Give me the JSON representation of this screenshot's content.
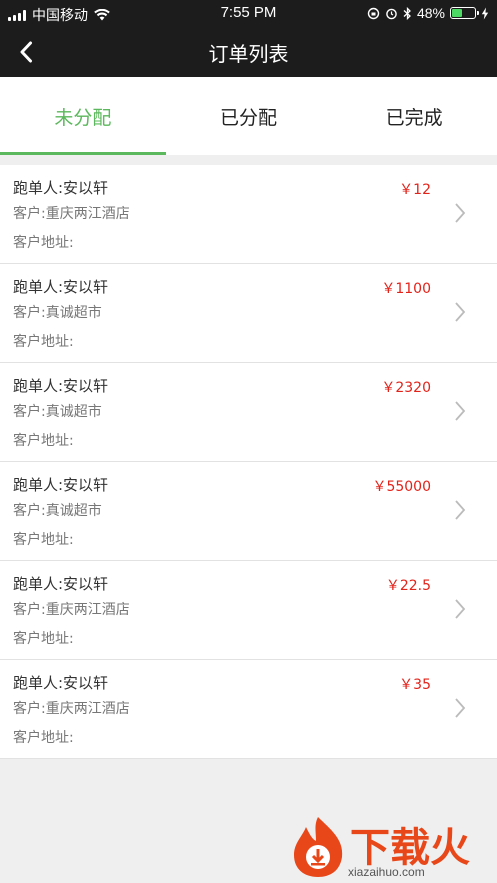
{
  "status_bar": {
    "carrier": "中国移动",
    "time": "7:55 PM",
    "battery_percent": "48%",
    "battery_level": 0.48,
    "battery_color": "#4cd964"
  },
  "nav": {
    "title": "订单列表",
    "back_icon": "chevron-left-icon"
  },
  "tabs": [
    {
      "label": "未分配",
      "active": true
    },
    {
      "label": "已分配",
      "active": false
    },
    {
      "label": "已完成",
      "active": false
    }
  ],
  "colors": {
    "accent": "#5cb85c",
    "price": "#e2231a",
    "header_bg": "#1c1c1c"
  },
  "orders": [
    {
      "runner": "跑单人:安以轩",
      "customer": "客户:重庆两江酒店",
      "address": "客户地址:",
      "price": "￥12"
    },
    {
      "runner": "跑单人:安以轩",
      "customer": "客户:真诚超市",
      "address": "客户地址:",
      "price": "￥1100"
    },
    {
      "runner": "跑单人:安以轩",
      "customer": "客户:真诚超市",
      "address": "客户地址:",
      "price": "￥2320"
    },
    {
      "runner": "跑单人:安以轩",
      "customer": "客户:真诚超市",
      "address": "客户地址:",
      "price": "￥55000"
    },
    {
      "runner": "跑单人:安以轩",
      "customer": "客户:重庆两江酒店",
      "address": "客户地址:",
      "price": "￥22.5"
    },
    {
      "runner": "跑单人:安以轩",
      "customer": "客户:重庆两江酒店",
      "address": "客户地址:",
      "price": "￥35"
    }
  ],
  "watermark": {
    "text": "下载火",
    "url": "xiazaihuo.com"
  }
}
